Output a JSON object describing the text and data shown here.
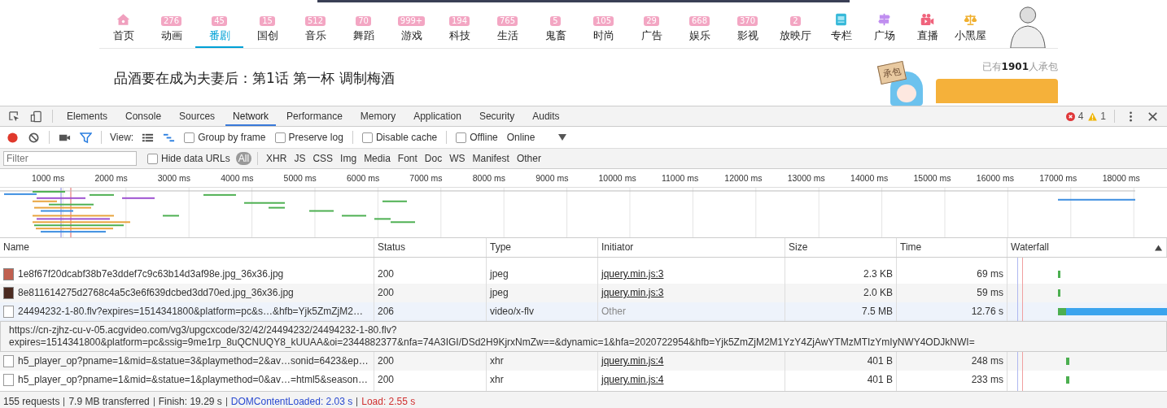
{
  "page": {
    "nav": [
      {
        "label": "首页",
        "kind": "home",
        "selected": false
      },
      {
        "label": "动画",
        "badge": "276",
        "kind": "badge",
        "selected": false
      },
      {
        "label": "番剧",
        "badge": "45",
        "kind": "badge",
        "selected": true
      },
      {
        "label": "国创",
        "badge": "15",
        "kind": "badge",
        "selected": false
      },
      {
        "label": "音乐",
        "badge": "512",
        "kind": "badge",
        "selected": false
      },
      {
        "label": "舞蹈",
        "badge": "70",
        "kind": "badge",
        "selected": false
      },
      {
        "label": "游戏",
        "badge": "999+",
        "kind": "badge",
        "selected": false
      },
      {
        "label": "科技",
        "badge": "194",
        "kind": "badge",
        "selected": false
      },
      {
        "label": "生活",
        "badge": "765",
        "kind": "badge",
        "selected": false
      },
      {
        "label": "鬼畜",
        "badge": "5",
        "kind": "badge",
        "selected": false
      },
      {
        "label": "时尚",
        "badge": "105",
        "kind": "badge",
        "selected": false
      },
      {
        "label": "广告",
        "badge": "29",
        "kind": "badge",
        "selected": false
      },
      {
        "label": "娱乐",
        "badge": "668",
        "kind": "badge",
        "selected": false
      },
      {
        "label": "影视",
        "badge": "370",
        "kind": "badge",
        "selected": false
      },
      {
        "label": "放映厅",
        "badge": "2",
        "kind": "badge",
        "selected": false
      },
      {
        "label": "专栏",
        "kind": "column",
        "selected": false
      },
      {
        "label": "广场",
        "kind": "signpost",
        "selected": false
      },
      {
        "label": "直播",
        "kind": "camera",
        "selected": false
      },
      {
        "label": "小黑屋",
        "kind": "scales",
        "selected": false
      }
    ],
    "title": "品酒要在成为夫妻后：第1话 第一杯 调制梅酒",
    "sign": "承包",
    "sponsor_count": "已有**1901**人承包"
  },
  "devtools": {
    "tabs": [
      {
        "label": "Elements",
        "selected": false
      },
      {
        "label": "Console",
        "selected": false
      },
      {
        "label": "Sources",
        "selected": false
      },
      {
        "label": "Network",
        "selected": true
      },
      {
        "label": "Performance",
        "selected": false
      },
      {
        "label": "Memory",
        "selected": false
      },
      {
        "label": "Application",
        "selected": false
      },
      {
        "label": "Security",
        "selected": false
      },
      {
        "label": "Audits",
        "selected": false
      }
    ],
    "errors": "4",
    "warnings": "1",
    "recording": true,
    "view_label": "View:",
    "checkboxes": [
      {
        "label": "Group by frame",
        "checked": false
      },
      {
        "label": "Preserve log",
        "checked": false
      },
      {
        "label": "Disable cache",
        "checked": false
      }
    ],
    "offline": {
      "label": "Offline",
      "checked": false
    },
    "throttling": "Online",
    "filter": {
      "placeholder": "Filter"
    },
    "hide_data_urls": {
      "label": "Hide data URLs",
      "checked": false
    },
    "types": [
      {
        "label": "All",
        "selected": true
      },
      {
        "label": "XHR",
        "selected": false
      },
      {
        "label": "JS",
        "selected": false
      },
      {
        "label": "CSS",
        "selected": false
      },
      {
        "label": "Img",
        "selected": false
      },
      {
        "label": "Media",
        "selected": false
      },
      {
        "label": "Font",
        "selected": false
      },
      {
        "label": "Doc",
        "selected": false
      },
      {
        "label": "WS",
        "selected": false
      },
      {
        "label": "Manifest",
        "selected": false
      },
      {
        "label": "Other",
        "selected": false
      }
    ],
    "ruler": [
      "1000 ms",
      "2000 ms",
      "3000 ms",
      "4000 ms",
      "5000 ms",
      "6000 ms",
      "7000 ms",
      "8000 ms",
      "9000 ms",
      "10000 ms",
      "11000 ms",
      "12000 ms",
      "13000 ms",
      "14000 ms",
      "15000 ms",
      "16000 ms",
      "17000 ms",
      "18000 ms"
    ],
    "table": {
      "columns": [
        "Name",
        "Status",
        "Type",
        "Initiator",
        "Size",
        "Time",
        "Waterfall"
      ],
      "rows": [
        {
          "name": "1e8f67f20dcabf38b7e3ddef7c9c63b14d3af98e.jpg_36x36.jpg",
          "status": "200",
          "type": "jpeg",
          "initiator": "jquery.min.js:3",
          "initiator_link": true,
          "size": "2.3 KB",
          "time": "69 ms",
          "kind": "image",
          "selected": false
        },
        {
          "name": "8e811614275d2768c4a5c3e6f639dcbed3dd70ed.jpg_36x36.jpg",
          "status": "200",
          "type": "jpeg",
          "initiator": "jquery.min.js:3",
          "initiator_link": true,
          "size": "2.0 KB",
          "time": "59 ms",
          "kind": "image-dark",
          "selected": false
        },
        {
          "name": "24494232-1-80.flv?expires=1514341800&platform=pc&s…&hfb=Yjk5ZmZjM2…",
          "status": "206",
          "type": "video/x-flv",
          "initiator": "Other",
          "initiator_link": false,
          "size": "7.5 MB",
          "time": "12.76 s",
          "kind": "file",
          "selected": true
        },
        {
          "name": "h5_player_op?pname=1&mid=&statue=3&playmethod=2&av…sonid=6423&ep…",
          "status": "200",
          "type": "xhr",
          "initiator": "jquery.min.js:4",
          "initiator_link": true,
          "size": "401 B",
          "time": "248 ms",
          "kind": "file",
          "selected": false
        },
        {
          "name": "h5_player_op?pname=1&mid=&statue=1&playmethod=0&av…=html5&season…",
          "status": "200",
          "type": "xhr",
          "initiator": "jquery.min.js:4",
          "initiator_link": true,
          "size": "401 B",
          "time": "233 ms",
          "kind": "file",
          "selected": false
        }
      ],
      "tooltip": [
        "https://cn-zjhz-cu-v-05.acgvideo.com/vg3/upgcxcode/32/42/24494232/24494232-1-80.flv?",
        "expires=1514341800&platform=pc&ssig=9me1rp_8uQCNUQY8_kUUAA&oi=2344882377&nfa=74A3IGI/DSd2H9KjrxNmZw==&dynamic=1&hfa=2020722954&hfb=Yjk5ZmZjM2M1YzY4ZjAwYTMzMTIzYmIyNWY4ODJkNWI="
      ]
    },
    "summary": [
      {
        "text": "155 requests",
        "kind": "plain"
      },
      {
        "text": "7.9 MB transferred",
        "kind": "plain"
      },
      {
        "text": "Finish: 19.29 s",
        "kind": "plain"
      },
      {
        "text": "DOMContentLoaded: 2.03 s",
        "kind": "dom"
      },
      {
        "text": "Load: 2.55 s",
        "kind": "load"
      }
    ]
  }
}
